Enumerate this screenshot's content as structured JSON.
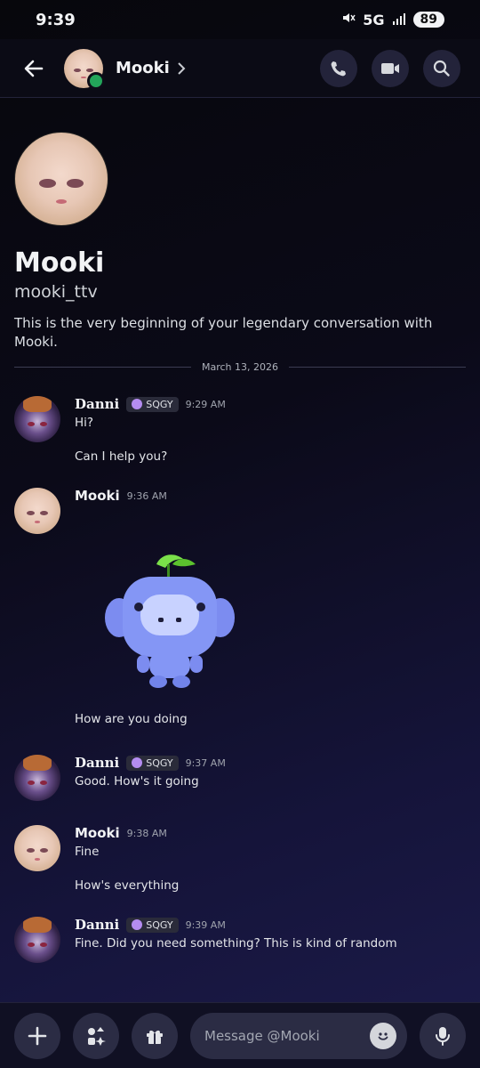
{
  "status_bar": {
    "time": "9:39",
    "network": "5G",
    "battery": "89"
  },
  "header": {
    "name": "Mooki",
    "icons": [
      "back-arrow-icon",
      "phone-icon",
      "video-camera-icon",
      "search-icon",
      "chevron-right-icon"
    ]
  },
  "profile": {
    "name": "Mooki",
    "handle": "mooki_ttv",
    "intro": "This is the very beginning of your legendary conversation with Mooki."
  },
  "date_divider": "March 13, 2026",
  "messages": [
    {
      "author": "Danni",
      "tag": "SQGY",
      "time": "9:29 AM",
      "lines": [
        "Hi?",
        "Can I help you?"
      ]
    },
    {
      "author": "Mooki",
      "time": "9:36 AM",
      "lines": [
        "How are you doing"
      ],
      "sticker": "wumpus-sticker"
    },
    {
      "author": "Danni",
      "tag": "SQGY",
      "time": "9:37 AM",
      "lines": [
        "Good. How's it going"
      ]
    },
    {
      "author": "Mooki",
      "time": "9:38 AM",
      "lines": [
        "Fine",
        "How's everything"
      ]
    },
    {
      "author": "Danni",
      "tag": "SQGY",
      "time": "9:39 AM",
      "lines": [
        "Fine. Did you need something? This is kind of random"
      ]
    }
  ],
  "composer": {
    "placeholder": "Message @Mooki"
  },
  "colors": {
    "online": "#23a55a",
    "background": "#0b0a18",
    "accent": "#5865f2"
  }
}
